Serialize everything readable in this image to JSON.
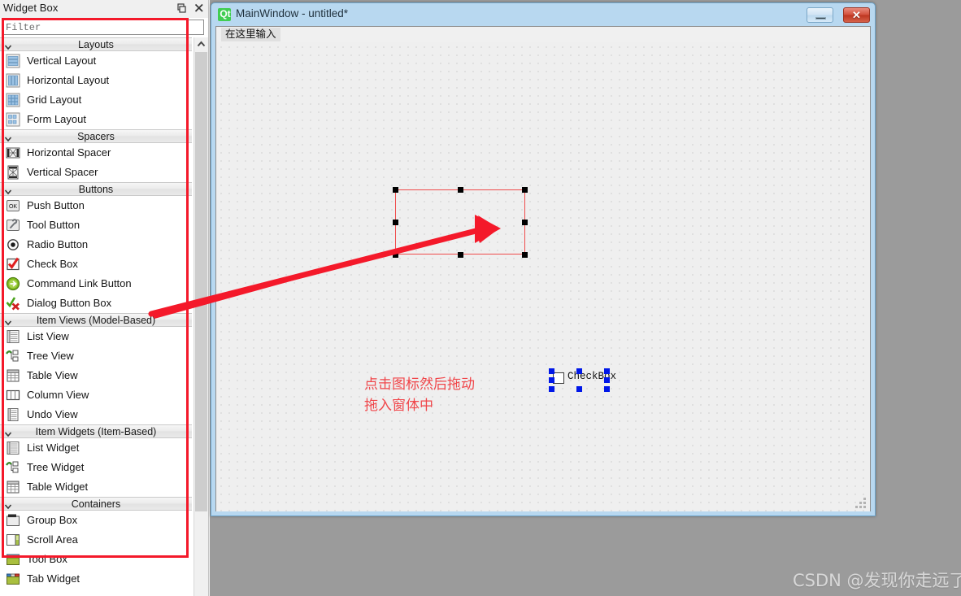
{
  "widget_box": {
    "title": "Widget Box",
    "float_button": "float-restore",
    "close_button": "close",
    "filter_placeholder": "Filter",
    "filter_value": "",
    "groups": [
      {
        "label": "Layouts",
        "expanded": true,
        "items": [
          {
            "label": "Vertical Layout",
            "icon": "vertical-layout-icon"
          },
          {
            "label": "Horizontal Layout",
            "icon": "horizontal-layout-icon"
          },
          {
            "label": "Grid Layout",
            "icon": "grid-layout-icon"
          },
          {
            "label": "Form Layout",
            "icon": "form-layout-icon"
          }
        ]
      },
      {
        "label": "Spacers",
        "expanded": true,
        "items": [
          {
            "label": "Horizontal Spacer",
            "icon": "horizontal-spacer-icon"
          },
          {
            "label": "Vertical Spacer",
            "icon": "vertical-spacer-icon"
          }
        ]
      },
      {
        "label": "Buttons",
        "expanded": true,
        "items": [
          {
            "label": "Push Button",
            "icon": "push-button-icon"
          },
          {
            "label": "Tool Button",
            "icon": "tool-button-icon"
          },
          {
            "label": "Radio Button",
            "icon": "radio-button-icon"
          },
          {
            "label": "Check Box",
            "icon": "check-box-icon"
          },
          {
            "label": "Command Link Button",
            "icon": "command-link-button-icon"
          },
          {
            "label": "Dialog Button Box",
            "icon": "dialog-button-box-icon"
          }
        ]
      },
      {
        "label": "Item Views (Model-Based)",
        "expanded": true,
        "items": [
          {
            "label": "List View",
            "icon": "list-view-icon"
          },
          {
            "label": "Tree View",
            "icon": "tree-view-icon"
          },
          {
            "label": "Table View",
            "icon": "table-view-icon"
          },
          {
            "label": "Column View",
            "icon": "column-view-icon"
          },
          {
            "label": "Undo View",
            "icon": "undo-view-icon"
          }
        ]
      },
      {
        "label": "Item Widgets (Item-Based)",
        "expanded": true,
        "items": [
          {
            "label": "List Widget",
            "icon": "list-widget-icon"
          },
          {
            "label": "Tree Widget",
            "icon": "tree-widget-icon"
          },
          {
            "label": "Table Widget",
            "icon": "table-widget-icon"
          }
        ]
      },
      {
        "label": "Containers",
        "expanded": true,
        "items": [
          {
            "label": "Group Box",
            "icon": "group-box-icon"
          },
          {
            "label": "Scroll Area",
            "icon": "scroll-area-icon"
          },
          {
            "label": "Tool Box",
            "icon": "tool-box-icon"
          },
          {
            "label": "Tab Widget",
            "icon": "tab-widget-icon"
          }
        ]
      }
    ]
  },
  "main_window": {
    "app_icon": "Qt",
    "title": "MainWindow - untitled*",
    "minimize_label": "–",
    "close_label": "✕",
    "menu_placeholder": "在这里输入",
    "canvas": {
      "checkbox_widget": {
        "label": "CheckBox",
        "selected": true,
        "handle_color": "#0017e8"
      },
      "selection_rect": {
        "selected": true,
        "handle_color": "#000000",
        "border_color": "#ef4b4b"
      }
    }
  },
  "annotations": {
    "note_line1": "点击图标然后拖动",
    "note_line2": "拖入窗体中",
    "arrow_color": "#f4192a",
    "highlight_color": "#f4192a"
  },
  "watermark": "CSDN @发现你走远了"
}
